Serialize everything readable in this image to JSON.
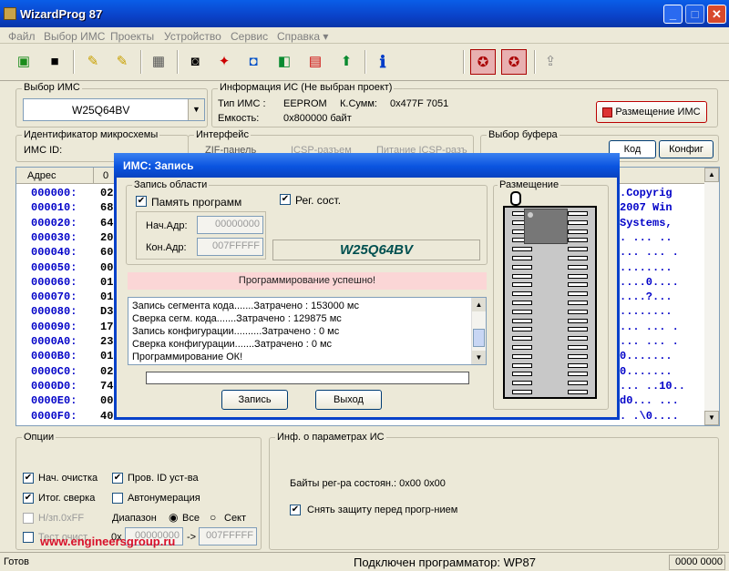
{
  "window": {
    "title": "WizardProg 87",
    "min": "_",
    "max": "□",
    "close": "✕"
  },
  "menu": [
    "Файл",
    "Выбор ИМС",
    "Проекты",
    "Устройство",
    "Сервис",
    "Справка ▾"
  ],
  "chip_select": {
    "label": "Выбор ИМС",
    "value": "W25Q64BV",
    "arrow": "▼"
  },
  "ic_info": {
    "label": "Информация ИС (Не выбран проект)",
    "type_label": "Тип ИМС :",
    "type_value": "EEPROM",
    "checksum_label": "К.Сумм:",
    "checksum_value": "0x477F 7051",
    "capacity_label": "Емкость:",
    "capacity_value": "0x800000 байт",
    "placement_button": "Размещение ИМС"
  },
  "chip_id": {
    "label": "Идентификатор микросхемы",
    "id_label": "ИМС ID:"
  },
  "interface": {
    "label": "Интерфейс",
    "zif": "ZIF-панель",
    "icsp": "ICSP-разъем",
    "icsp_power": "Питание ICSP-разъ"
  },
  "buffer": {
    "label": "Выбор буфера",
    "tab_code": "Код",
    "tab_config": "Конфиг"
  },
  "hex": {
    "col_addr": "Адрес",
    "col0": "0",
    "rows": [
      {
        "addr": "000000:",
        "data": "02",
        "ascii": ".Copyrig"
      },
      {
        "addr": "000010:",
        "data": "68",
        "ascii": "2007 Win"
      },
      {
        "addr": "000020:",
        "data": "64",
        "ascii": "Systems,"
      },
      {
        "addr": "000030:",
        "data": "20",
        "ascii": ". ... .."
      },
      {
        "addr": "000040:",
        "data": "60",
        "ascii": "... ... ."
      },
      {
        "addr": "000050:",
        "data": "00",
        "ascii": "........"
      },
      {
        "addr": "000060:",
        "data": "01",
        "ascii": "....0...."
      },
      {
        "addr": "000070:",
        "data": "01",
        "ascii": "....?..."
      },
      {
        "addr": "000080:",
        "data": "D3",
        "ascii": "........"
      },
      {
        "addr": "000090:",
        "data": "17",
        "ascii": "... ... ."
      },
      {
        "addr": "0000A0:",
        "data": "23",
        "ascii": "... ... ."
      },
      {
        "addr": "0000B0:",
        "data": "01",
        "ascii": "0......."
      },
      {
        "addr": "0000C0:",
        "data": "02",
        "ascii": "0......."
      },
      {
        "addr": "0000D0:",
        "data": "74",
        "ascii": "... ..10.."
      },
      {
        "addr": "0000E0:",
        "data": "00",
        "ascii": "d0... ..."
      },
      {
        "addr": "0000F0:",
        "data": "40 20 40 E3 5C 30 4F E5 00 20 83 E5 00 20 40 E3",
        "ascii": ". .\\0...."
      }
    ]
  },
  "dialog": {
    "title": "ИМС: Запись",
    "write_area": "Запись области",
    "program_memory": "Память программ",
    "reg_state": "Рег. сост.",
    "start_addr_label": "Нач.Адр:",
    "start_addr": "00000000",
    "end_addr_label": "Кон.Адр:",
    "end_addr": "007FFFFF",
    "chip_name": "W25Q64BV",
    "success": "Программирование успешно!",
    "log": [
      "Запись сегмента кода.......Затрачено   : 153000 мс",
      "Сверка сегм. кода.......Затрачено   : 129875 мс",
      "Запись конфигурации..........Затрачено   : 0 мс",
      "Сверка конфигурации.......Затрачено   : 0 мс",
      "Программирование ОК!"
    ],
    "write_button": "Запись",
    "exit_button": "Выход",
    "placement_label": "Размещение",
    "progress": 0
  },
  "options": {
    "label": "Опции",
    "pre_erase": "Нач. очистка",
    "check_id": "Пров. ID уст-ва",
    "final_verify": "Итог. сверка",
    "autonumber": "Автонумерация",
    "blank_ff": "Н/зп.0xFF",
    "range_label": "Диапазон",
    "range_all": "Все",
    "range_sect": "Сект",
    "test_erase": "Тест очист.",
    "range_prefix": "0x",
    "range_from": "00000000",
    "range_arrow": "->",
    "range_to": "007FFFFF"
  },
  "params": {
    "label": "Инф. о параметрах ИС",
    "status_regs": "Байты рег-ра состоян.: 0x00 0x00",
    "remove_protect": "Снять защиту перед прогр-нием"
  },
  "watermark": "www.engineersgroup.ru",
  "status": {
    "ready": "Готов",
    "connected": "Подключен программатор: WP87",
    "code": "0000 0000"
  }
}
